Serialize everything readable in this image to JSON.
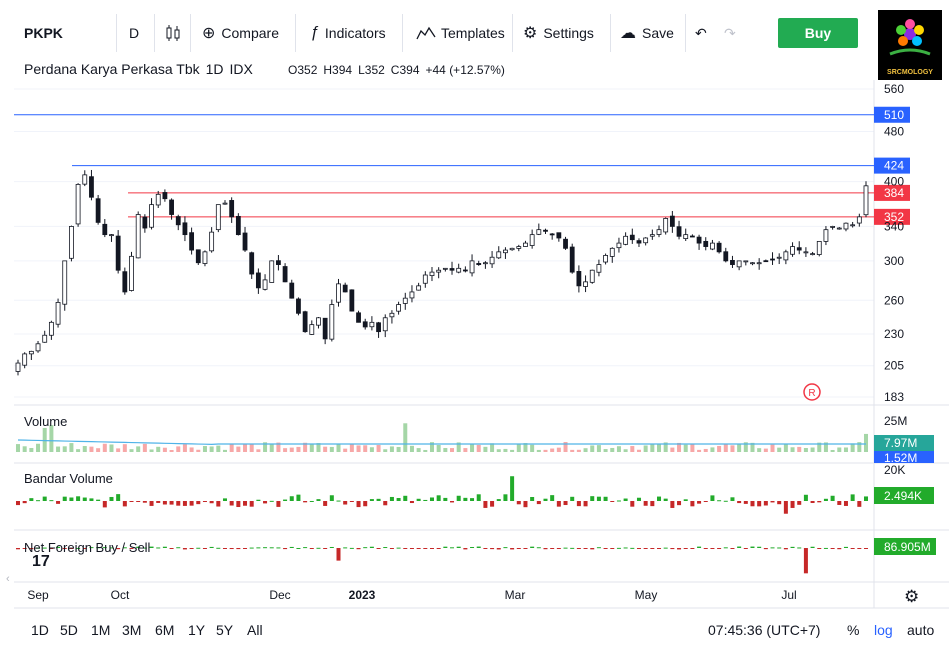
{
  "toolbar": {
    "symbol": "PKPK",
    "interval": "D",
    "compare_label": "Compare",
    "indicators_label": "Indicators",
    "templates_label": "Templates",
    "settings_label": "Settings",
    "save_label": "Save",
    "buy_label": "Buy",
    "logo_text": "SRCMOLOGY"
  },
  "header": {
    "title": "Perdana Karya Perkasa Tbk",
    "interval": "1D",
    "exchange": "IDX",
    "ohlc": {
      "o_label": "O",
      "o": "352",
      "h_label": "H",
      "h": "394",
      "l_label": "L",
      "l": "352",
      "c_label": "C",
      "c": "394",
      "change": "+44 (+12.57%)"
    }
  },
  "price_axis": {
    "ticks": [
      "560",
      "480",
      "400",
      "340",
      "300",
      "260",
      "230",
      "205",
      "183"
    ],
    "tick_values": [
      560,
      480,
      400,
      340,
      300,
      260,
      230,
      205,
      183
    ],
    "levels": [
      {
        "label": "510",
        "value": 510,
        "color": "#2962ff"
      },
      {
        "label": "424",
        "value": 424,
        "color": "#2962ff"
      },
      {
        "label": "384",
        "value": 384,
        "color": "#f23645"
      },
      {
        "label": "352",
        "value": 352,
        "color": "#f23645"
      }
    ],
    "scale": "log"
  },
  "panes": {
    "volume": {
      "title": "Volume",
      "axis_tick": "25M",
      "badge_1": "7.97M",
      "badge_1_color": "#26a69a",
      "badge_2": "1.52M",
      "badge_2_color": "#2962ff"
    },
    "bandar": {
      "title": "Bandar Volume",
      "axis_tick": "20K",
      "badge": "2.494K",
      "badge_color": "#22ab2b"
    },
    "foreign": {
      "title": "Net Foreign Buy / Sell",
      "badge": "86.905M",
      "badge_color": "#22ab2b"
    }
  },
  "time_axis": {
    "labels": [
      "Sep",
      "Oct",
      "Dec",
      "2023",
      "Mar",
      "May",
      "Jul"
    ]
  },
  "bottom_bar": {
    "ranges": [
      "1D",
      "5D",
      "1M",
      "3M",
      "6M",
      "1Y",
      "5Y",
      "All"
    ],
    "clock": "07:45:36 (UTC+7)",
    "pct": "%",
    "log": "log",
    "auto": "auto"
  },
  "colors": {
    "up": "#ffffff",
    "down": "#131722",
    "accent": "#2962ff",
    "buy": "#22ab52"
  },
  "chart_data": {
    "type": "candlestick",
    "title": "Perdana Karya Perkasa Tbk",
    "yscale": "log",
    "ylim": [
      183,
      560
    ],
    "x_start": "2022-08-24",
    "x_end": "2023-08-01",
    "series": [
      {
        "name": "price_close",
        "values": [
          207,
          214,
          216,
          222,
          229,
          240,
          258,
          300,
          340,
          396,
          410,
          378,
          345,
          330,
          330,
          290,
          268,
          305,
          355,
          338,
          368,
          382,
          376,
          355,
          342,
          330,
          312,
          298,
          310,
          333,
          368,
          370,
          352,
          330,
          312,
          286,
          272,
          280,
          300,
          296,
          278,
          262,
          248,
          232,
          238,
          244,
          226,
          256,
          276,
          268,
          250,
          240,
          236,
          240,
          232,
          244,
          248,
          256,
          262,
          268,
          274,
          285,
          288,
          290,
          292,
          290,
          292,
          290,
          300,
          296,
          298,
          304,
          310,
          312,
          314,
          316,
          320,
          330,
          336,
          334,
          330,
          326,
          314,
          288,
          274,
          278,
          290,
          296,
          306,
          314,
          320,
          328,
          324,
          320,
          326,
          330,
          336,
          350,
          340,
          328,
          330,
          328,
          320,
          316,
          320,
          310,
          300,
          296,
          300,
          300,
          298,
          298,
          300,
          302,
          304,
          310,
          316,
          312,
          310,
          308,
          322,
          336,
          340,
          338,
          344,
          342,
          352,
          394
        ]
      }
    ]
  }
}
